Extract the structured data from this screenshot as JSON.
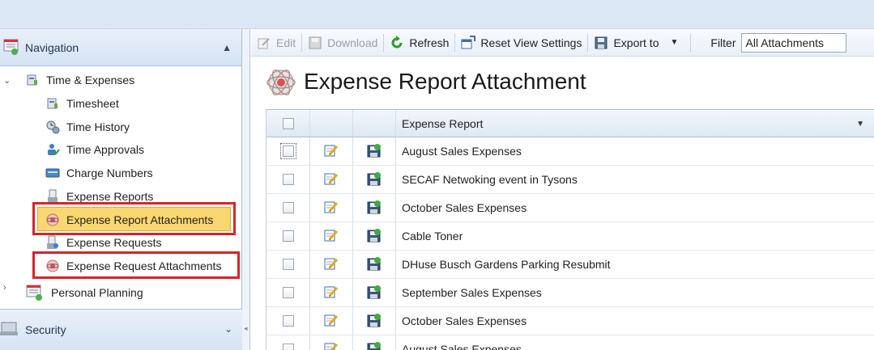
{
  "navigation": {
    "header": "Navigation",
    "tree": {
      "root_label": "Time & Expenses",
      "items": [
        {
          "label": "Timesheet",
          "icon": "timesheet-icon"
        },
        {
          "label": "Time History",
          "icon": "time-history-icon"
        },
        {
          "label": "Time Approvals",
          "icon": "time-approvals-icon"
        },
        {
          "label": "Charge Numbers",
          "icon": "charge-numbers-icon"
        },
        {
          "label": "Expense Reports",
          "icon": "expense-reports-icon"
        },
        {
          "label": "Expense Report Attachments",
          "icon": "attachment-icon",
          "selected": true
        },
        {
          "label": "Expense Requests",
          "icon": "expense-requests-icon"
        },
        {
          "label": "Expense Request Attachments",
          "icon": "attachment-icon"
        }
      ],
      "sibling_label": "Personal Planning"
    },
    "security_header": "Security"
  },
  "toolbar": {
    "edit": "Edit",
    "download": "Download",
    "refresh": "Refresh",
    "reset": "Reset View Settings",
    "export": "Export to",
    "filter_label": "Filter",
    "filter_value": "All Attachments"
  },
  "page": {
    "title": "Expense Report Attachment"
  },
  "grid": {
    "column_header": "Expense Report",
    "rows": [
      "August Sales Expenses",
      "SECAF Netwoking event in Tysons",
      "October Sales Expenses",
      "Cable Toner",
      "DHuse Busch Gardens Parking Resubmit",
      "September Sales Expenses",
      "October Sales Expenses",
      "August Sales Expenses"
    ]
  },
  "colors": {
    "selected_bg": "#fbd772",
    "highlight_border": "#d7242a",
    "header_bg": "#d5e3f3"
  }
}
